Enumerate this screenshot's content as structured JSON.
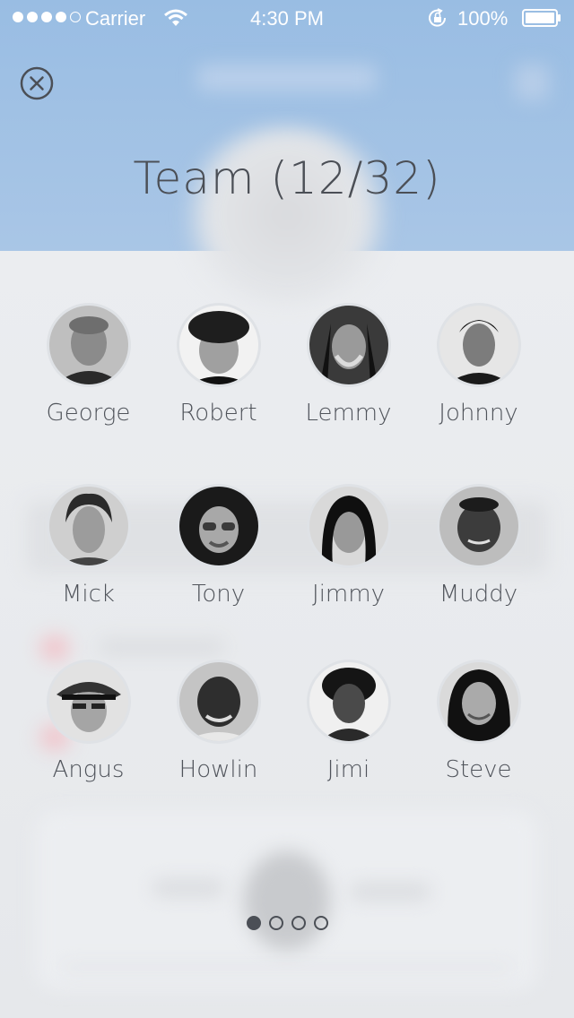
{
  "status_bar": {
    "carrier": "Carrier",
    "time": "4:30 PM",
    "battery": "100%",
    "signal_dots": [
      true,
      true,
      true,
      true,
      false
    ]
  },
  "header": {
    "close_icon": "close-circle-icon",
    "title": "Team (12/32)"
  },
  "team": [
    {
      "name": "George"
    },
    {
      "name": "Robert"
    },
    {
      "name": "Lemmy"
    },
    {
      "name": "Johnny"
    },
    {
      "name": "Mick"
    },
    {
      "name": "Tony"
    },
    {
      "name": "Jimmy"
    },
    {
      "name": "Muddy"
    },
    {
      "name": "Angus"
    },
    {
      "name": "Howlin"
    },
    {
      "name": "Jimi"
    },
    {
      "name": "Steve"
    }
  ],
  "pager": {
    "pages": 4,
    "current": 1
  },
  "colors": {
    "header_blue": "#99bde3",
    "text": "#4b4f56",
    "background": "#e9ebee"
  }
}
